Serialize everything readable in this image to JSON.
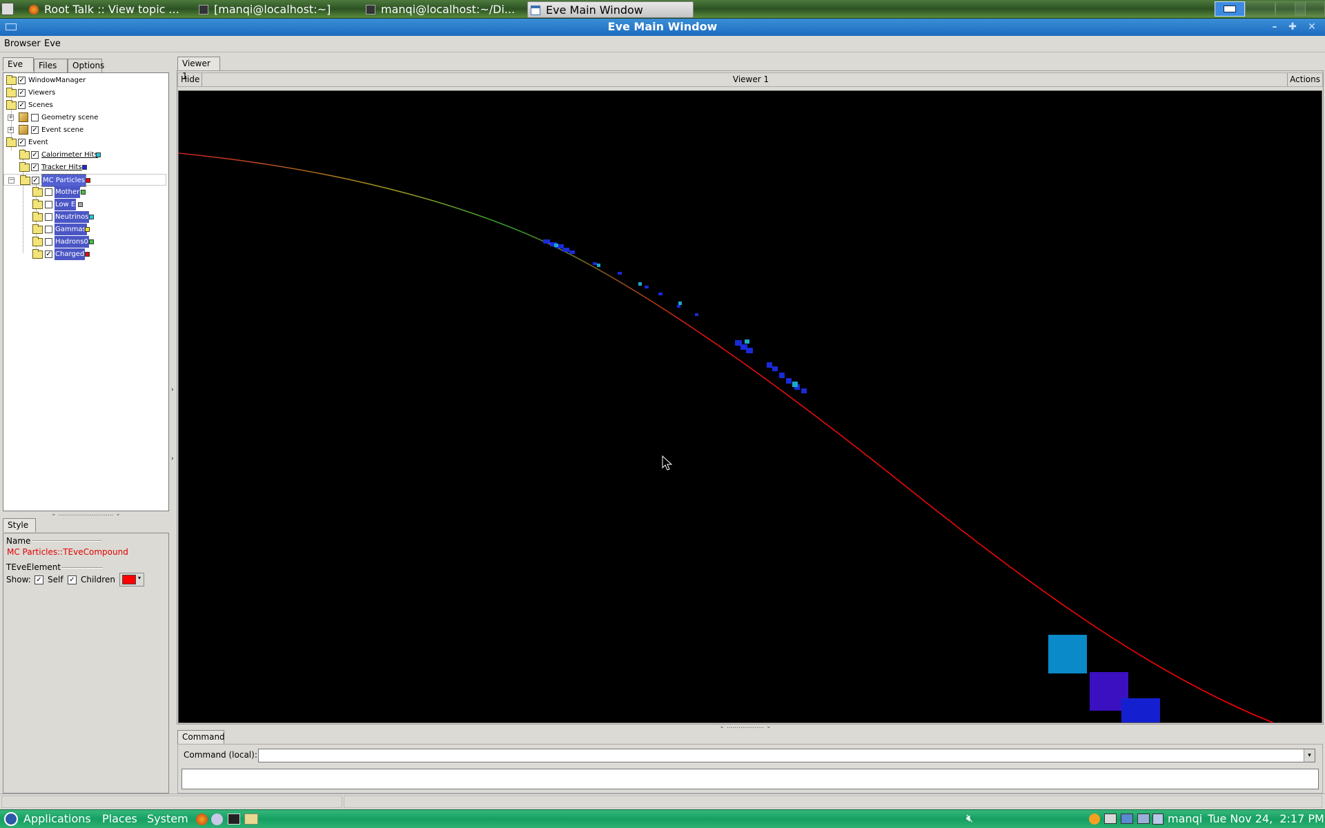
{
  "taskbar": {
    "tasks": [
      {
        "label": "Root Talk :: View topic ..."
      },
      {
        "label": "[manqi@localhost:~]"
      },
      {
        "label": "manqi@localhost:~/Di..."
      },
      {
        "label": "Eve Main Window"
      }
    ]
  },
  "window": {
    "title": "Eve Main Window"
  },
  "menubar": {
    "items": [
      "Browser",
      "Eve"
    ]
  },
  "left_tabs": [
    "Eve",
    "Files",
    "Options"
  ],
  "tree": {
    "items": [
      {
        "label": "WindowManager",
        "checked": true
      },
      {
        "label": "Viewers",
        "checked": true
      },
      {
        "label": "Scenes",
        "checked": true
      },
      {
        "label": "Geometry scene",
        "checked": false
      },
      {
        "label": "Event scene",
        "checked": true
      },
      {
        "label": "Event",
        "checked": true
      },
      {
        "label": "Calorimeter Hits",
        "checked": true,
        "color": "#22c8d8"
      },
      {
        "label": "Tracker Hits",
        "checked": true,
        "color": "#1a2ad8"
      },
      {
        "label": "MC Particles",
        "checked": true,
        "color": "#e01010"
      },
      {
        "label": "Mother",
        "checked": false,
        "color": "#3cc83c"
      },
      {
        "label": "Low E",
        "checked": false,
        "color": "#a8a8a0"
      },
      {
        "label": "Neutrinos",
        "checked": false,
        "color": "#22c8d8"
      },
      {
        "label": "Gammas",
        "checked": false,
        "color": "#f0e020"
      },
      {
        "label": "Hadrons0",
        "checked": false,
        "color": "#3cc83c"
      },
      {
        "label": "Charged",
        "checked": true,
        "color": "#e01010"
      }
    ]
  },
  "style_panel": {
    "tab": "Style",
    "name_label": "Name",
    "name_value": "MC Particles::TEveCompound",
    "section_label": "TEveElement",
    "show_label": "Show:",
    "self_label": "Self",
    "children_label": "Children",
    "self_checked": true,
    "children_checked": true,
    "color": "#ff0000"
  },
  "viewer": {
    "tab": "Viewer 1",
    "hide_label": "Hide",
    "title": "Viewer 1",
    "actions_label": "Actions"
  },
  "command": {
    "tab": "Command",
    "label": "Command (local):",
    "value": ""
  },
  "bottom_panel": {
    "menus": [
      "Applications",
      "Places",
      "System"
    ],
    "user": "manqi",
    "datetime": "Tue Nov 24,  2:17 PM"
  },
  "colors": {
    "track": "#ff0000",
    "hit_blue": "#1a2ad8",
    "hit_cyan": "#1aa8c8",
    "calo_cyan": "#0a8ac8",
    "calo_violet": "#3a10c0",
    "calo_blue": "#1420d0"
  }
}
